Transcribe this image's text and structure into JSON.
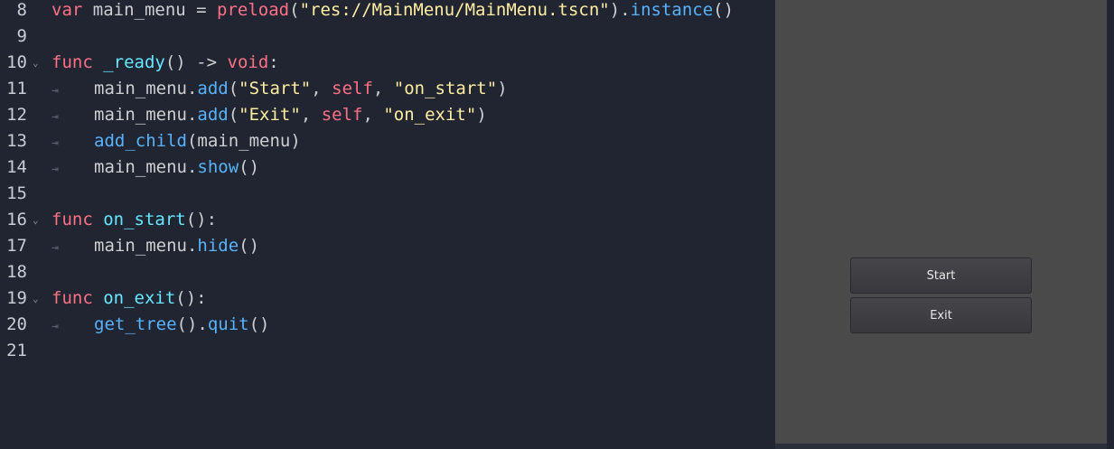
{
  "editor": {
    "lines": [
      {
        "num": "8",
        "fold": "",
        "indent": false,
        "tokens": [
          [
            "kw",
            "var "
          ],
          [
            "id",
            "main_menu "
          ],
          [
            "p",
            "= "
          ],
          [
            "kw",
            "preload"
          ],
          [
            "p",
            "("
          ],
          [
            "str",
            "\"res://MainMenu/MainMenu.tscn\""
          ],
          [
            "p",
            ")."
          ],
          [
            "fn",
            "instance"
          ],
          [
            "p",
            "()"
          ]
        ]
      },
      {
        "num": "9",
        "fold": "",
        "indent": false,
        "tokens": []
      },
      {
        "num": "10",
        "fold": "⌄",
        "indent": false,
        "tokens": [
          [
            "kw",
            "func "
          ],
          [
            "dfn",
            "_ready"
          ],
          [
            "p",
            "() "
          ],
          [
            "p",
            "-> "
          ],
          [
            "kw",
            "void"
          ],
          [
            "p",
            ":"
          ]
        ]
      },
      {
        "num": "11",
        "fold": "",
        "indent": true,
        "tokens": [
          [
            "id",
            "main_menu."
          ],
          [
            "fn",
            "add"
          ],
          [
            "p",
            "("
          ],
          [
            "str",
            "\"Start\""
          ],
          [
            "p",
            ", "
          ],
          [
            "kw",
            "self"
          ],
          [
            "p",
            ", "
          ],
          [
            "str",
            "\"on_start\""
          ],
          [
            "p",
            ")"
          ]
        ]
      },
      {
        "num": "12",
        "fold": "",
        "indent": true,
        "tokens": [
          [
            "id",
            "main_menu."
          ],
          [
            "fn",
            "add"
          ],
          [
            "p",
            "("
          ],
          [
            "str",
            "\"Exit\""
          ],
          [
            "p",
            ", "
          ],
          [
            "kw",
            "self"
          ],
          [
            "p",
            ", "
          ],
          [
            "str",
            "\"on_exit\""
          ],
          [
            "p",
            ")"
          ]
        ]
      },
      {
        "num": "13",
        "fold": "",
        "indent": true,
        "tokens": [
          [
            "fn",
            "add_child"
          ],
          [
            "p",
            "("
          ],
          [
            "id",
            "main_menu"
          ],
          [
            "p",
            ")"
          ]
        ]
      },
      {
        "num": "14",
        "fold": "",
        "indent": true,
        "tokens": [
          [
            "id",
            "main_menu."
          ],
          [
            "fn",
            "show"
          ],
          [
            "p",
            "()"
          ]
        ]
      },
      {
        "num": "15",
        "fold": "",
        "indent": false,
        "tokens": []
      },
      {
        "num": "16",
        "fold": "⌄",
        "indent": false,
        "tokens": [
          [
            "kw",
            "func "
          ],
          [
            "dfn",
            "on_start"
          ],
          [
            "p",
            "():"
          ]
        ]
      },
      {
        "num": "17",
        "fold": "",
        "indent": true,
        "tokens": [
          [
            "id",
            "main_menu."
          ],
          [
            "fn",
            "hide"
          ],
          [
            "p",
            "()"
          ]
        ]
      },
      {
        "num": "18",
        "fold": "",
        "indent": false,
        "tokens": []
      },
      {
        "num": "19",
        "fold": "⌄",
        "indent": false,
        "tokens": [
          [
            "kw",
            "func "
          ],
          [
            "dfn",
            "on_exit"
          ],
          [
            "p",
            "():"
          ]
        ]
      },
      {
        "num": "20",
        "fold": "",
        "indent": true,
        "tokens": [
          [
            "fn",
            "get_tree"
          ],
          [
            "p",
            "()."
          ],
          [
            "fn",
            "quit"
          ],
          [
            "p",
            "()"
          ]
        ]
      },
      {
        "num": "21",
        "fold": "",
        "indent": false,
        "tokens": []
      }
    ],
    "indent_glyph": "⇥"
  },
  "preview": {
    "start_label": "Start",
    "exit_label": "Exit"
  },
  "colors": {
    "editor_bg": "#202531",
    "keyword": "#ff7085",
    "function": "#57b3ff",
    "string": "#ffeda1",
    "preview_bg": "#4a4a4a"
  }
}
